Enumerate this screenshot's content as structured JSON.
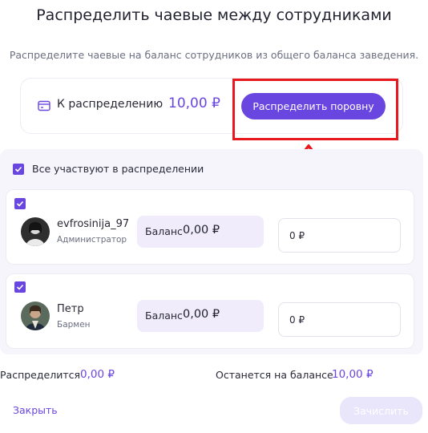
{
  "header": {
    "title": "Распределить чаевые между сотрудниками",
    "subtitle": "Распределите чаевые на баланс сотрудников из общего баланса заведения."
  },
  "distribution": {
    "label": "К распределению",
    "amount": "10,00 ₽",
    "equal_button": "Распределить поровну"
  },
  "all_participate": {
    "label": "Все участвуют в распределении",
    "checked": true
  },
  "employees": [
    {
      "name": "evfrosinija_97",
      "role": "Администратор",
      "balance_label": "Баланс",
      "balance": "0,00 ₽",
      "amount": "0 ₽",
      "checked": true
    },
    {
      "name": "Петр",
      "role": "Бармен",
      "balance_label": "Баланс",
      "balance": "0,00 ₽",
      "amount": "0 ₽",
      "checked": true
    }
  ],
  "summary": {
    "distributed_label": "Распределится",
    "distributed_value": "0,00 ₽",
    "remaining_label": "Останется на балансе",
    "remaining_value": "10,00 ₽"
  },
  "footer": {
    "close_label": "Закрыть",
    "credit_button": "Зачислить"
  },
  "colors": {
    "accent": "#6a46e0",
    "highlight": "#e8191e",
    "panel_bg": "#f6f5fc",
    "disabled_button": "#e9e5fb"
  },
  "icons": {
    "distribution": "wallet-card-icon",
    "annotation": "arrow-up-icon",
    "check": "checkmark-icon"
  }
}
